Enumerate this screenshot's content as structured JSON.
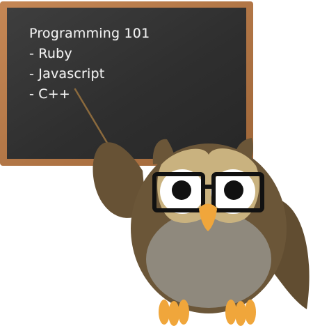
{
  "chalkboard": {
    "lines": [
      "Programming 101",
      "- Ruby",
      "- Javascript",
      "- C++"
    ]
  },
  "colors": {
    "frame": "#b87a4b",
    "board": "#333333",
    "owl_body": "#6b5638",
    "owl_belly": "#8f897d",
    "owl_face": "#c9b27f",
    "beak": "#f0a63b",
    "feet": "#f0a63b",
    "glasses": "#111111"
  }
}
